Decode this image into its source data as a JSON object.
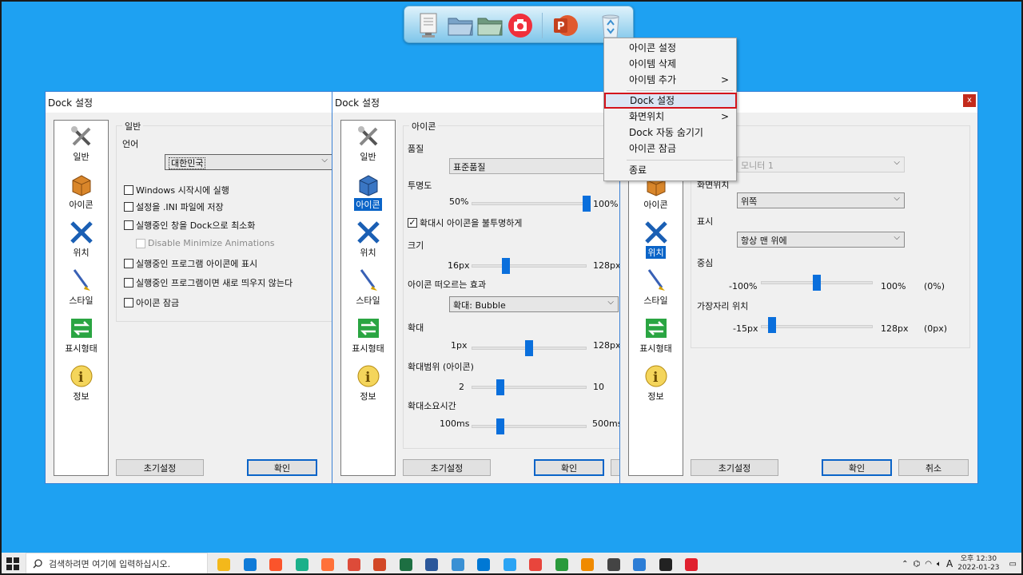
{
  "dock": {
    "icons": [
      "computer-icon",
      "folder-icon",
      "folder-icon",
      "camera-icon",
      "powerpoint-icon",
      "recycle-bin-icon"
    ],
    "ppt_letter": "P"
  },
  "context_menu": {
    "items": [
      {
        "label": "아이콘 설정"
      },
      {
        "label": "아이템 삭제"
      },
      {
        "label": "아이템 추가",
        "arrow": ">"
      },
      {
        "label": "Dock 설정"
      },
      {
        "label": "화면위치",
        "arrow": ">"
      },
      {
        "label": "Dock 자동 숨기기"
      },
      {
        "label": "아이콘 잠금"
      },
      {
        "label": "종료"
      }
    ]
  },
  "sidebar": {
    "items": [
      {
        "label": "일반",
        "icon": "tools-icon"
      },
      {
        "label": "아이콘",
        "icon": "box-icon"
      },
      {
        "label": "위치",
        "icon": "arrows-icon"
      },
      {
        "label": "스타일",
        "icon": "brush-icon"
      },
      {
        "label": "표시형태",
        "icon": "swap-icon"
      },
      {
        "label": "정보",
        "icon": "info-icon"
      }
    ]
  },
  "window1": {
    "title": "Dock 설정",
    "group_label": "일반",
    "language_label": "언어",
    "language_value": "대한민국",
    "checks": [
      {
        "label": "Windows 시작시에 실행",
        "checked": false
      },
      {
        "label": "설정을 .INI 파일에 저장",
        "checked": false
      },
      {
        "label": "실행중인 창을 Dock으로 최소화",
        "checked": false
      },
      {
        "label": "Disable Minimize Animations",
        "checked": false,
        "disabled": true
      },
      {
        "label": "실행중인 프로그램 아이콘에 표시",
        "checked": false
      },
      {
        "label": "실행중인 프로그램이면 새로 띄우지 않는다",
        "checked": false
      },
      {
        "label": "아이콘 잠금",
        "checked": false
      }
    ],
    "reset_label": "초기설정",
    "ok_label": "확인"
  },
  "window2": {
    "title": "Dock 설정",
    "group_label": "아이콘",
    "quality_label": "품질",
    "quality_value": "표준품질",
    "opacity_label": "투명도",
    "opacity_min": "50%",
    "opacity_max": "100%",
    "opacity_value": 1.0,
    "opaque_check": "확대시 아이콘을 불투명하게",
    "opaque_checked": true,
    "size_label": "크기",
    "size_min": "16px",
    "size_max": "128px",
    "size_value": 0.3,
    "effect_label": "아이콘 떠오르는 효과",
    "effect_value": "확대: Bubble",
    "zoom_label": "확대",
    "zoom_min": "1px",
    "zoom_max": "128px",
    "zoom_value": 0.5,
    "range_label": "확대범위 (아이콘)",
    "range_min": "2",
    "range_max": "10",
    "range_value": 0.25,
    "duration_label": "확대소요시간",
    "duration_min": "100ms",
    "duration_max": "500ms",
    "duration_value": 0.25,
    "reset_label": "초기설정",
    "ok_label": "확인"
  },
  "window3": {
    "monitor_value": "모니터 1",
    "position_label": "화면위치",
    "position_value": "위쪽",
    "display_label": "표시",
    "display_value": "항상 맨 위에",
    "center_label": "중심",
    "center_min": "-100%",
    "center_max": "100%",
    "center_readout": "(0%)",
    "center_value": 0.5,
    "edge_label": "가장자리 위치",
    "edge_min": "-15px",
    "edge_max": "128px",
    "edge_readout": "(0px)",
    "edge_value": 0.1,
    "close_label": "x",
    "reset_label": "초기설정",
    "ok_label": "확인",
    "cancel_label": "취소"
  },
  "taskbar": {
    "search_placeholder": "검색하려면 여기에 입력하십시오.",
    "time": "오후 12:30",
    "date": "2022-01-23",
    "ime": "A",
    "app_colors": [
      "#f3b81b",
      "#0f7bd8",
      "#fb542b",
      "#1bb08a",
      "#ff7139",
      "#dd4b39",
      "#d24726",
      "#1d6f42",
      "#2b579a",
      "#3a90d4",
      "#0078d4",
      "#2aa4f4",
      "#e8453c",
      "#2a9a3c",
      "#f08a00",
      "#444444",
      "#2c7dd6",
      "#222222",
      "#e0202e"
    ]
  }
}
